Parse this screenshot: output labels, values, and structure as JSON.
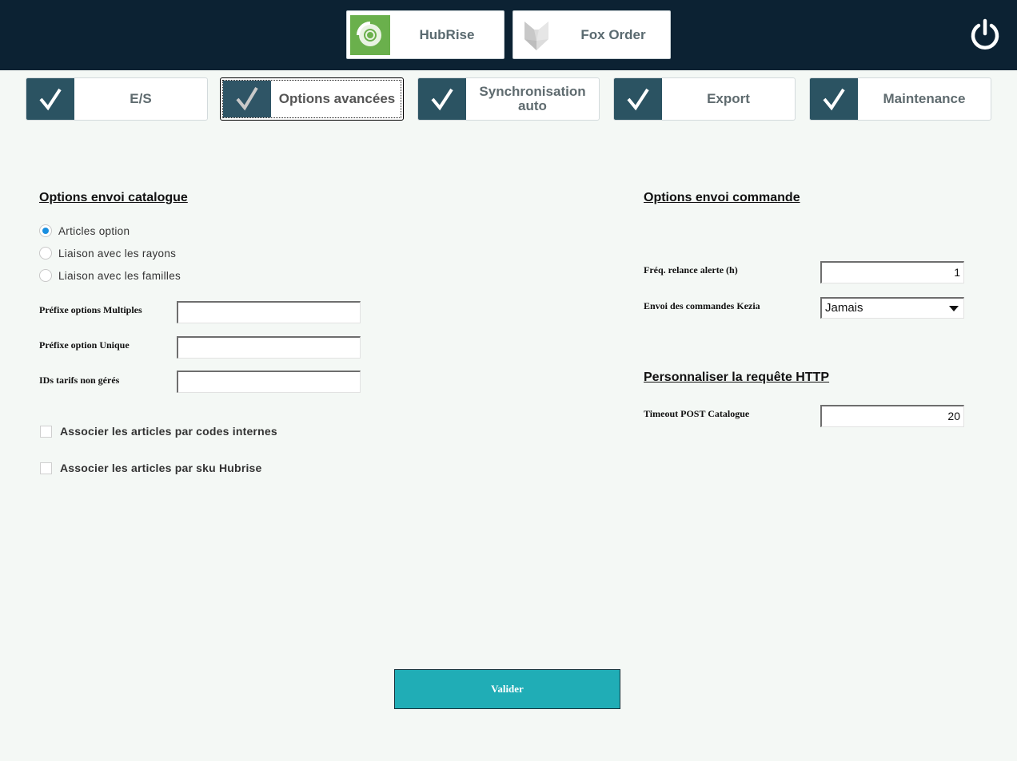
{
  "header": {
    "apps": [
      {
        "label": "HubRise",
        "icon": "hubrise-logo-icon"
      },
      {
        "label": "Fox Order",
        "icon": "fox-logo-icon"
      }
    ],
    "power_icon": "power-icon"
  },
  "tabs": [
    {
      "label": "E/S",
      "checked": true
    },
    {
      "label": "Options avancées",
      "checked": true,
      "active": true
    },
    {
      "label": "Synchronisation auto",
      "checked": true
    },
    {
      "label": "Export",
      "checked": true
    },
    {
      "label": "Maintenance",
      "checked": true
    }
  ],
  "catalogue": {
    "title": "Options envoi catalogue",
    "radios": [
      {
        "label": "Articles option",
        "selected": true
      },
      {
        "label": "Liaison avec les rayons",
        "selected": false
      },
      {
        "label": "Liaison avec les familles",
        "selected": false
      }
    ],
    "fields": [
      {
        "label": "Préfixe options Multiples",
        "value": ""
      },
      {
        "label": "Préfixe option Unique",
        "value": ""
      },
      {
        "label": "IDs tarifs non gérés",
        "value": ""
      }
    ],
    "checkboxes": [
      {
        "label": "Associer les articles par codes internes",
        "checked": false
      },
      {
        "label": "Associer les articles par sku Hubrise",
        "checked": false
      }
    ]
  },
  "commande": {
    "title": "Options envoi commande",
    "freq_label": "Fréq. relance alerte (h)",
    "freq_value": "1",
    "envoi_label": "Envoi des commandes Kezia",
    "envoi_value": "Jamais"
  },
  "http": {
    "title": "Personnaliser la requête HTTP",
    "timeout_label": "Timeout POST Catalogue",
    "timeout_value": "20"
  },
  "footer": {
    "submit_label": "Valider"
  },
  "colors": {
    "topbar": "#0c2233",
    "tab_check": "#2b5362",
    "submit": "#20adb6",
    "radio_selected": "#1a8fe0",
    "hubrise_green": "#6ab04c"
  }
}
